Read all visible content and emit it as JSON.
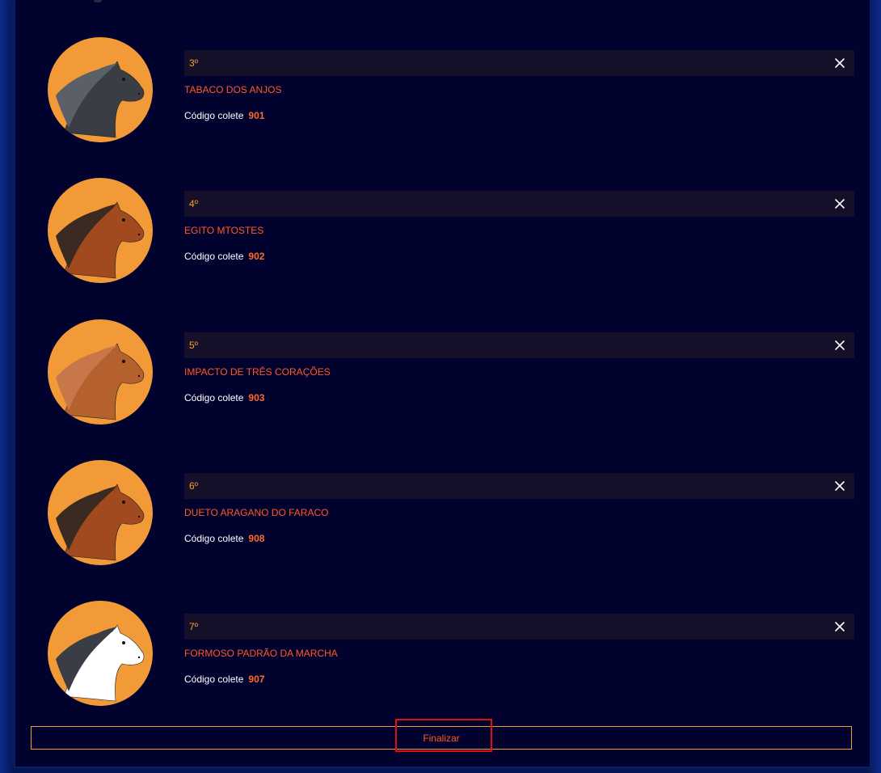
{
  "entries": [
    {
      "position": "3º",
      "name": "TABACO DOS ANJOS",
      "code_label": "Código colete",
      "code": "901",
      "horse_color": "#3a3d44",
      "mane_color": "#5a5f68",
      "icon": "horse-head-dark-icon"
    },
    {
      "position": "4º",
      "name": "EGITO MTOSTES",
      "code_label": "Código colete",
      "code": "902",
      "horse_color": "#a24a1f",
      "mane_color": "#3a2a22",
      "icon": "horse-head-chestnut-icon"
    },
    {
      "position": "5º",
      "name": "IMPACTO DE TRÊS CORAÇÕES",
      "code_label": "Código colete",
      "code": "903",
      "horse_color": "#b5612e",
      "mane_color": "#c8774a",
      "icon": "horse-head-bay-icon"
    },
    {
      "position": "6º",
      "name": "DUETO ARAGANO DO FARACO",
      "code_label": "Código colete",
      "code": "908",
      "horse_color": "#a24a1f",
      "mane_color": "#3a2a22",
      "icon": "horse-head-chestnut-icon"
    },
    {
      "position": "7º",
      "name": "FORMOSO PADRÃO DA MARCHA",
      "code_label": "Código colete",
      "code": "907",
      "horse_color": "#ffffff",
      "mane_color": "#3a3d44",
      "icon": "horse-head-white-icon"
    }
  ],
  "finish_label": "Finalizar",
  "colors": {
    "accent_orange": "#f39a38",
    "name_red_orange": "#ff5a24",
    "background": "#02022e"
  }
}
